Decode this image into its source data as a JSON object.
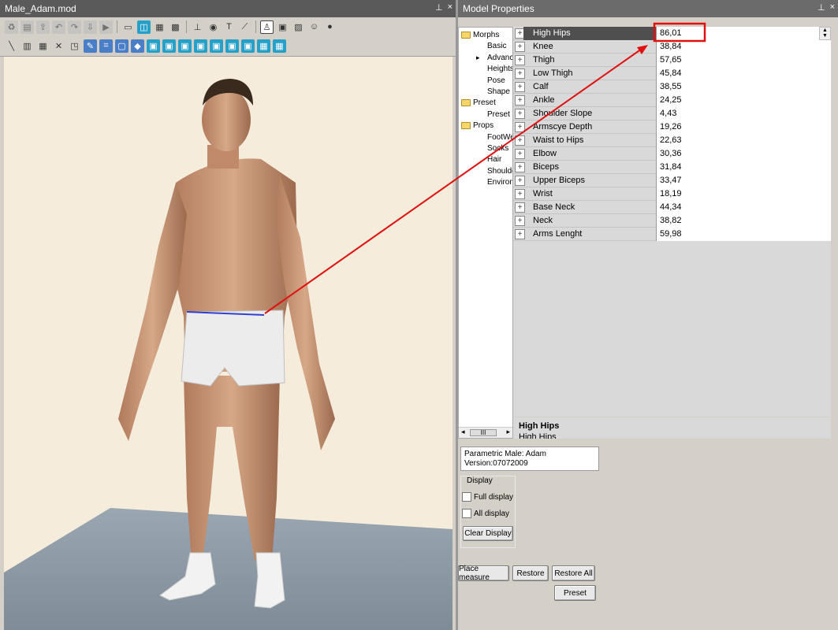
{
  "left_panel": {
    "title": "Male_Adam.mod"
  },
  "right_panel": {
    "title": "Model Properties"
  },
  "window_controls": {
    "pin": "⊥",
    "close": "×"
  },
  "toolbar": {
    "row1": [
      "recycle-icon",
      "open-file-icon",
      "export-icon",
      "undo-icon",
      "redo-icon",
      "import-icon",
      "play-icon",
      "frame-icon",
      "split-view-icon",
      "layers-icon",
      "grid-icon",
      "axis-icon",
      "camera-icon",
      "text-tool-icon",
      "ruler-icon",
      "pose-icon",
      "monitor-icon",
      "image-icon",
      "user-settings-icon",
      "sphere-icon"
    ],
    "row2": [
      "line-tool-icon",
      "columns-icon",
      "grid-tool-icon",
      "scale-icon",
      "select-icon",
      "edit-icon",
      "bone-icon",
      "box-icon",
      "cube-icon",
      "front-view-icon",
      "back-view-icon",
      "left-view-icon",
      "right-view-icon",
      "top-view-icon",
      "bottom-view-icon",
      "perspective-icon",
      "wireframe-icon",
      "texture-icon"
    ]
  },
  "tree": {
    "items": [
      {
        "label": "Morphs",
        "folder": true
      },
      {
        "label": "Basic",
        "folder": false
      },
      {
        "label": "Advanc",
        "folder": false
      },
      {
        "label": "Heights",
        "folder": false
      },
      {
        "label": "Pose",
        "folder": false
      },
      {
        "label": "Shape",
        "folder": false
      },
      {
        "label": "Preset",
        "folder": true
      },
      {
        "label": "Preset",
        "folder": false
      },
      {
        "label": "Props",
        "folder": true
      },
      {
        "label": "FootWe",
        "folder": false
      },
      {
        "label": "Socks",
        "folder": false
      },
      {
        "label": "Hair",
        "folder": false
      },
      {
        "label": "Shoulde",
        "folder": false
      },
      {
        "label": "Environ",
        "folder": false
      }
    ],
    "scroll_label": "III"
  },
  "properties": {
    "rows": [
      {
        "name": "High Hips",
        "value": "86,01"
      },
      {
        "name": "Knee",
        "value": "38,84"
      },
      {
        "name": "Thigh",
        "value": "57,65"
      },
      {
        "name": "Low Thigh",
        "value": "45,84"
      },
      {
        "name": "Calf",
        "value": "38,55"
      },
      {
        "name": "Ankle",
        "value": "24,25"
      },
      {
        "name": "Shoulder Slope",
        "value": "4,43"
      },
      {
        "name": "Armscye Depth",
        "value": "19,26"
      },
      {
        "name": "Waist to Hips",
        "value": "22,63"
      },
      {
        "name": "Elbow",
        "value": "30,36"
      },
      {
        "name": "Biceps",
        "value": "31,84"
      },
      {
        "name": "Upper Biceps",
        "value": "33,47"
      },
      {
        "name": "Wrist",
        "value": "18,19"
      },
      {
        "name": "Base Neck",
        "value": "44,34"
      },
      {
        "name": "Neck",
        "value": "38,82"
      },
      {
        "name": "Arms Lenght",
        "value": "59,98"
      }
    ],
    "selected": "High Hips",
    "expand_symbol": "+"
  },
  "description": {
    "title": "High Hips",
    "text": "High Hips"
  },
  "info": {
    "line1": "Parametric Male: Adam",
    "line2": "Version:07072009"
  },
  "display": {
    "legend": "Display",
    "full_display": "Full display",
    "all_display": "All display",
    "clear_button": "Clear Display"
  },
  "buttons": {
    "place_measure": "Place measure",
    "restore": "Restore",
    "restore_all": "Restore All",
    "preset": "Preset"
  },
  "colors": {
    "annotation": "#e01010",
    "selected_row": "#4f4f4f",
    "viewport_bg": "#f5ecdc",
    "floor": "#8e9aa6"
  }
}
